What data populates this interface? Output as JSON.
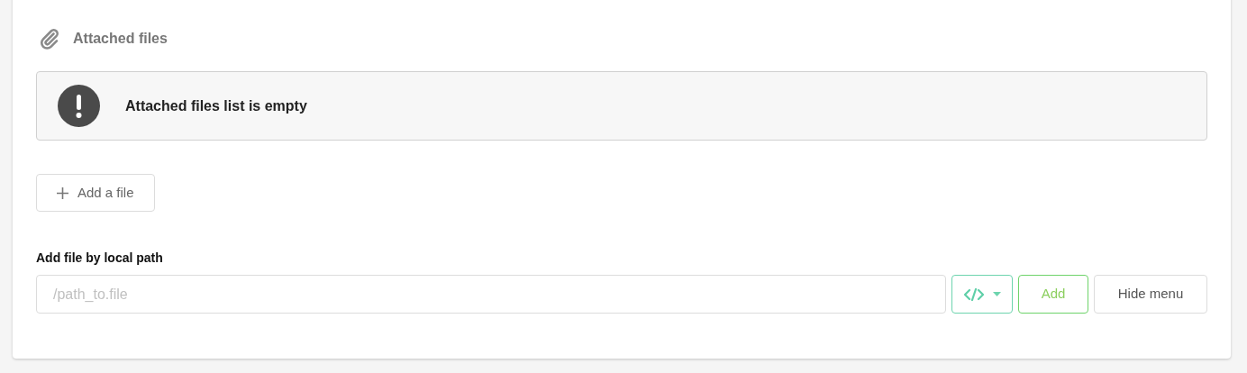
{
  "section": {
    "title": "Attached files"
  },
  "notice": {
    "message": "Attached files list is empty"
  },
  "add_button": {
    "label": "Add a file"
  },
  "local_path": {
    "label": "Add file by local path",
    "placeholder": "/path_to.file",
    "buttons": [
      {
        "kind": "code"
      },
      {
        "kind": "add",
        "label": "Add"
      },
      {
        "kind": "plain",
        "label": "Hide menu"
      }
    ]
  }
}
